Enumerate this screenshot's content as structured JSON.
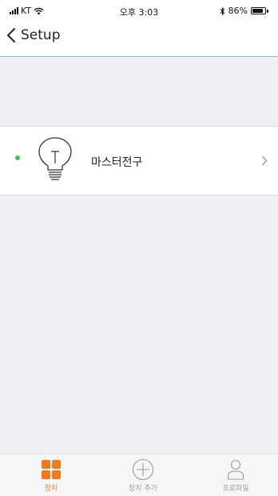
{
  "status_bar": {
    "carrier": "KT",
    "time": "오후 3:03",
    "battery": "86%",
    "battery_level": 0.86,
    "icons": [
      "signal-icon",
      "wifi-icon",
      "bluetooth-icon",
      "battery-icon"
    ]
  },
  "nav": {
    "back_icon": "chevron-left-icon",
    "title": "Setup"
  },
  "devices": [
    {
      "label": "마스터전구",
      "online": true,
      "status_color": "#3fc45a",
      "icon": "lightbulb-icon",
      "action_icon": "chevron-right-icon"
    }
  ],
  "tabbar": {
    "active_color": "#f07a1d",
    "tabs": [
      {
        "label": "장치",
        "icon": "grid-icon",
        "active": true
      },
      {
        "label": "장치 추가",
        "icon": "plus-circle-icon",
        "active": false
      },
      {
        "label": "프로파일",
        "icon": "person-icon",
        "active": false
      }
    ]
  },
  "colors": {
    "nav_underline": "#7ec4dc",
    "background": "#efeff4"
  }
}
